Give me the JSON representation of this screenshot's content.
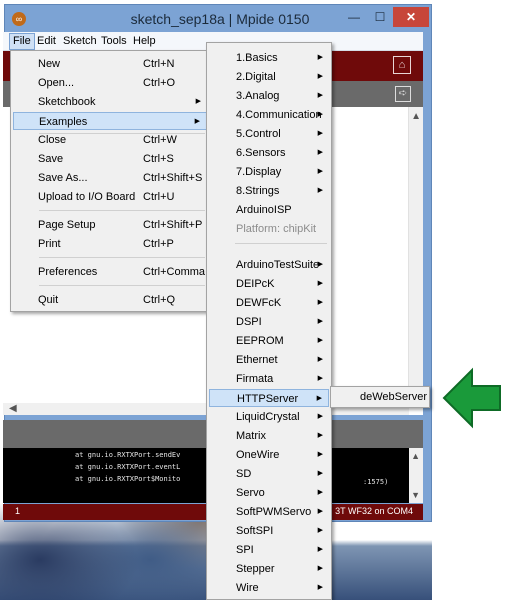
{
  "window": {
    "title": "sketch_sep18a | Mpide 0150",
    "controls": {
      "minimize": "—",
      "maximize": "☐",
      "close": "✕"
    }
  },
  "menubar": {
    "file": "File",
    "edit": "Edit",
    "sketch": "Sketch",
    "tools": "Tools",
    "help": "Help"
  },
  "file_menu": {
    "items": [
      {
        "label": "New",
        "shortcut": "Ctrl+N"
      },
      {
        "label": "Open...",
        "shortcut": "Ctrl+O"
      },
      {
        "label": "Sketchbook",
        "shortcut": ""
      },
      {
        "label": "Examples",
        "shortcut": ""
      },
      {
        "label": "Close",
        "shortcut": "Ctrl+W"
      },
      {
        "label": "Save",
        "shortcut": "Ctrl+S"
      },
      {
        "label": "Save As...",
        "shortcut": "Ctrl+Shift+S"
      },
      {
        "label": "Upload to I/O Board",
        "shortcut": "Ctrl+U"
      },
      {
        "label": "Page Setup",
        "shortcut": "Ctrl+Shift+P"
      },
      {
        "label": "Print",
        "shortcut": "Ctrl+P"
      },
      {
        "label": "Preferences",
        "shortcut": "Ctrl+Comma"
      },
      {
        "label": "Quit",
        "shortcut": "Ctrl+Q"
      }
    ]
  },
  "examples_menu": {
    "items": [
      "1.Basics",
      "2.Digital",
      "3.Analog",
      "4.Communication",
      "5.Control",
      "6.Sensors",
      "7.Display",
      "8.Strings",
      "ArduinoISP",
      "Platform: chipKit",
      "ArduinoTestSuite",
      "DEIPcK",
      "DEWFcK",
      "DSPI",
      "EEPROM",
      "Ethernet",
      "Firmata",
      "HTTPServer",
      "LiquidCrystal",
      "Matrix",
      "OneWire",
      "SD",
      "Servo",
      "SoftPWMServo",
      "SoftSPI",
      "SPI",
      "Stepper",
      "Wire"
    ]
  },
  "httpserver_menu": {
    "item": "deWebServer"
  },
  "console": {
    "lines": [
      "at gnu.io.RXTXPort.sendEv",
      "at gnu.io.RXTXPort.eventL",
      "at gnu.io.RXTXPort$Monito"
    ],
    "tail": ":1575)"
  },
  "footer": {
    "line": "1",
    "board": "3T WF32 on COM4"
  },
  "colors": {
    "accent_red": "#6f0a0a",
    "highlight": "#cfe3f8",
    "arrow_green": "#1a9a3a"
  },
  "icons": {
    "app": "mpide-icon",
    "serial_monitor": "serial-monitor-icon",
    "tab_menu": "tab-menu-icon",
    "pointer": "green-arrow-icon"
  }
}
